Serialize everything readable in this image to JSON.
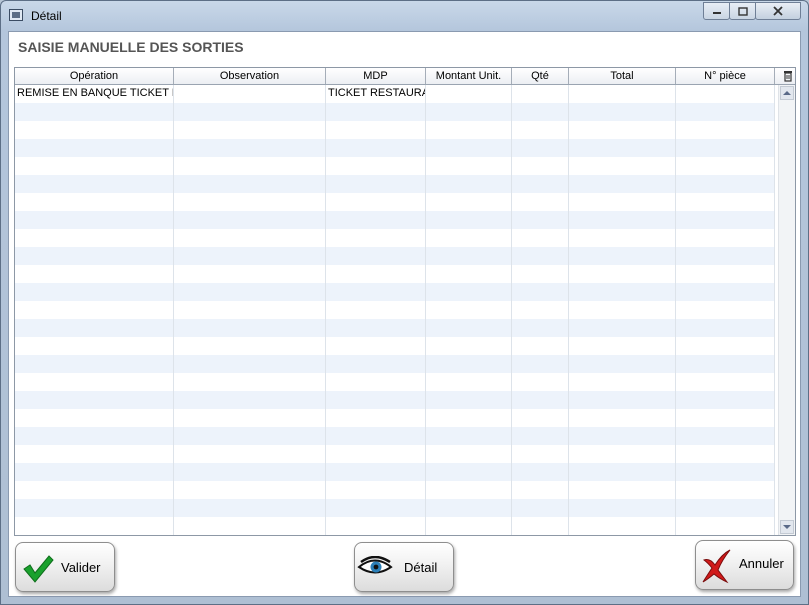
{
  "window": {
    "title": "Détail"
  },
  "heading": "SAISIE MANUELLE DES SORTIES",
  "table": {
    "columns": [
      "Opération",
      "Observation",
      "MDP",
      "Montant Unit.",
      "Qté",
      "Total",
      "N° pièce"
    ],
    "rows": [
      [
        "REMISE EN BANQUE TICKET R",
        "",
        "TICKET RESTAURANT",
        "",
        "",
        "",
        ""
      ]
    ]
  },
  "buttons": {
    "valider": "Valider",
    "detail": "Détail",
    "annuler": "Annuler"
  },
  "colors": {
    "check": "#1aa12d",
    "cross": "#d11a1a",
    "eye": "#2b7fb8"
  }
}
